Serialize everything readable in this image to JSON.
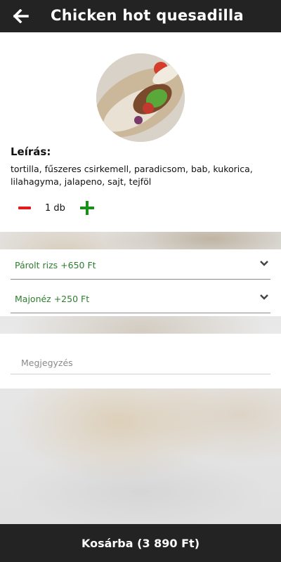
{
  "header": {
    "title": "Chicken hot quesadilla",
    "back_icon": "arrow-left-icon"
  },
  "product": {
    "image_icon": "food-photo",
    "description_label": "Leírás:",
    "description": "tortilla, fűszeres csirkemell, paradicsom, bab, kukorica, lilahagyma, jalapeno, sajt, tejföl"
  },
  "quantity": {
    "value_text": "1 db",
    "minus_icon": "minus-icon",
    "plus_icon": "plus-icon"
  },
  "options": [
    {
      "label": "Párolt rizs +650 Ft"
    },
    {
      "label": "Majonéz +250 Ft"
    }
  ],
  "note": {
    "placeholder": "Megjegyzés",
    "value": ""
  },
  "cart": {
    "button_label": "Kosárba (3 890 Ft)"
  },
  "colors": {
    "bar": "#232323",
    "minus": "#e41a1a",
    "plus": "#1a8f1a",
    "option_text": "#2e7d2e"
  }
}
